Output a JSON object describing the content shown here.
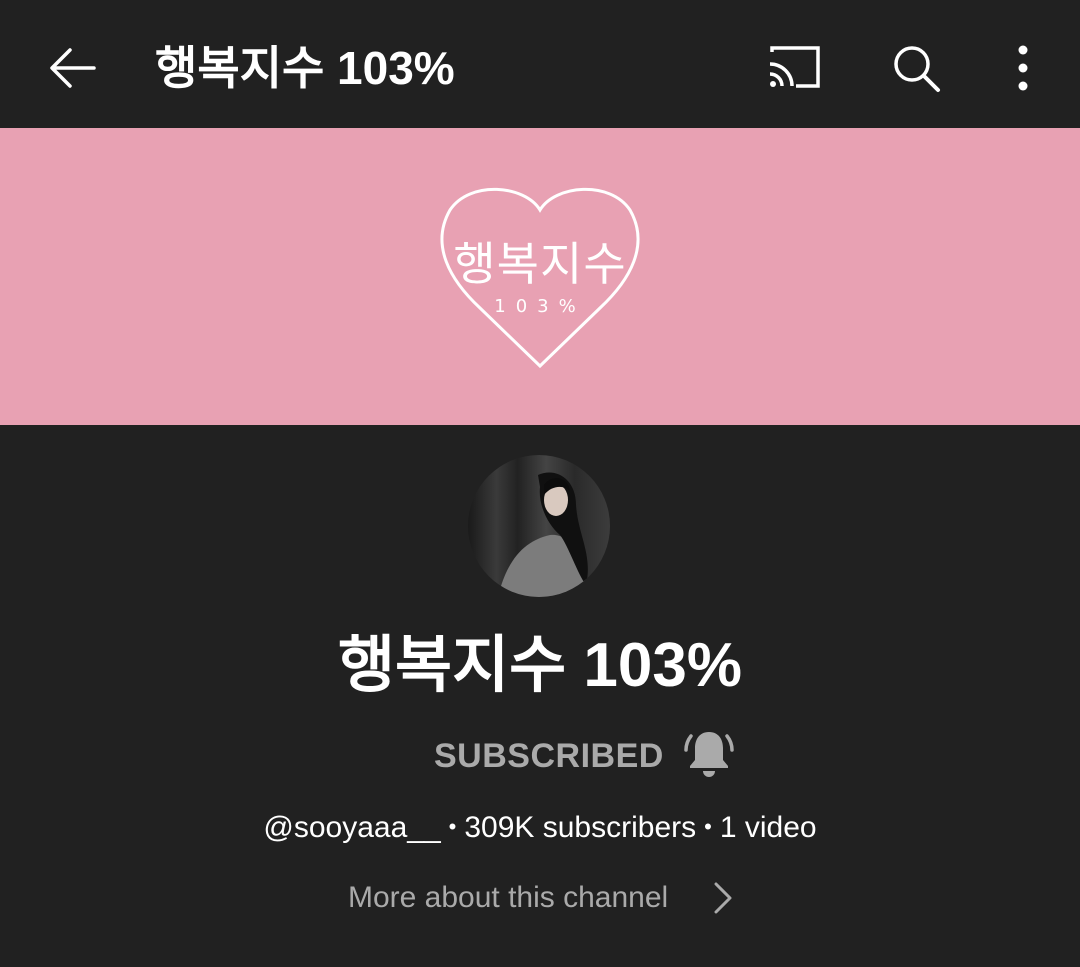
{
  "header": {
    "title": "행복지수 103%",
    "icons": [
      "back-arrow-icon",
      "cast-icon",
      "search-icon",
      "more-vert-icon"
    ]
  },
  "banner": {
    "background_color": "#e8a1b3",
    "logo_text": "행복지수",
    "logo_sub": "103%"
  },
  "channel": {
    "name": "행복지수 103%",
    "subscribe_state": "SUBSCRIBED",
    "handle": "@sooyaaa__",
    "subscribers": "309K subscribers",
    "videos": "1 video",
    "separator": "•",
    "more_about": "More about this channel"
  },
  "colors": {
    "background": "#212121",
    "text_primary": "#ffffff",
    "text_secondary": "#aaaaaa"
  }
}
